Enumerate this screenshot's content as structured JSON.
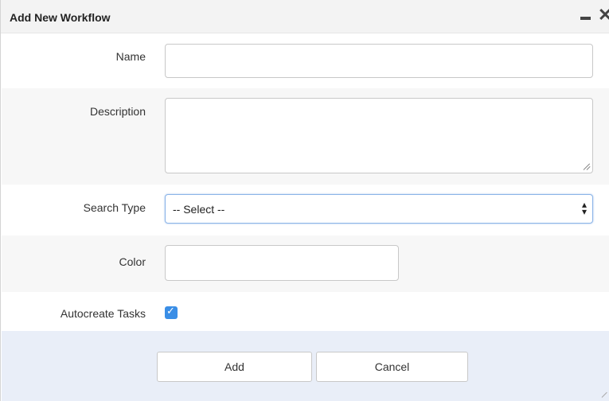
{
  "dialog": {
    "title": "Add New Workflow",
    "minimize_icon": "minimize-icon",
    "close_icon": "close-icon"
  },
  "form": {
    "name": {
      "label": "Name",
      "value": ""
    },
    "description": {
      "label": "Description",
      "value": ""
    },
    "search_type": {
      "label": "Search Type",
      "selected": "-- Select --",
      "arrow_icon": "updown-arrows-icon"
    },
    "color": {
      "label": "Color",
      "value": ""
    },
    "autocreate_tasks": {
      "label": "Autocreate Tasks",
      "checked": true,
      "accent": "#3a8ee6"
    }
  },
  "footer": {
    "add_label": "Add",
    "cancel_label": "Cancel"
  }
}
